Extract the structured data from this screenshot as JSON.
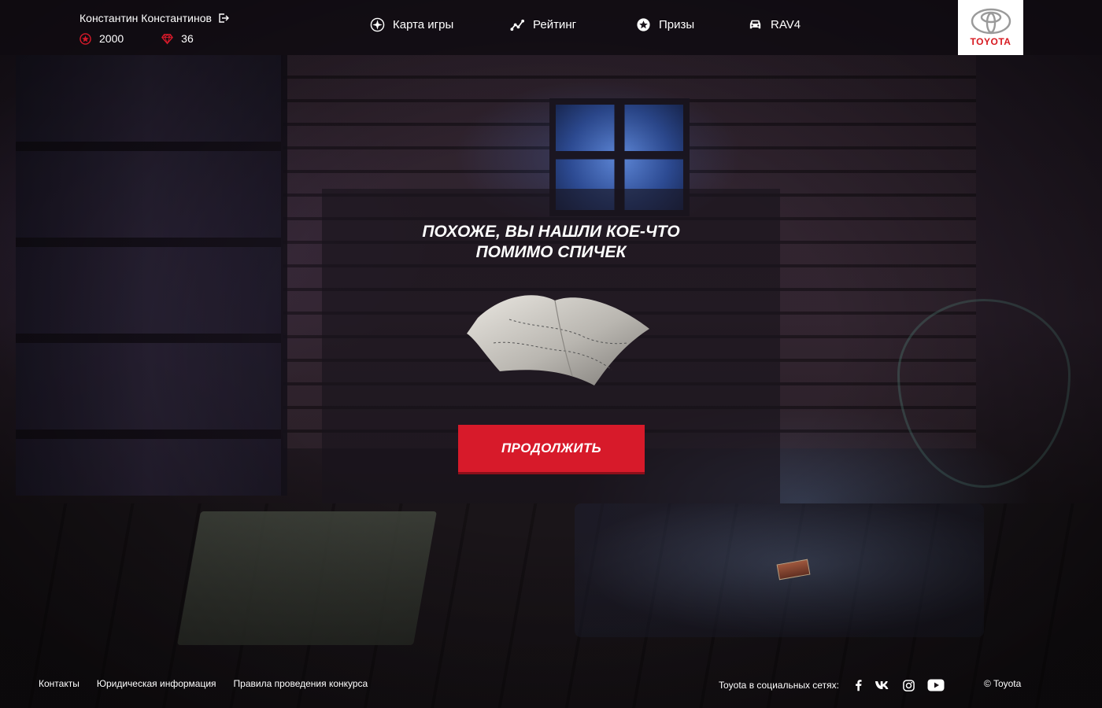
{
  "user": {
    "name": "Константин Константинов",
    "points": "2000",
    "gems": "36"
  },
  "nav": {
    "items": [
      {
        "label": "Карта игры",
        "icon": "compass-icon"
      },
      {
        "label": "Рейтинг",
        "icon": "chart-line-icon"
      },
      {
        "label": "Призы",
        "icon": "star-badge-icon"
      },
      {
        "label": "RAV4",
        "icon": "car-icon"
      }
    ]
  },
  "brand": {
    "name": "TOYOTA",
    "color": "#d71920"
  },
  "modal": {
    "title_line1": "Похоже, вы нашли кое-что",
    "title_line2": "помимо спичек",
    "found_item": "map-scroll",
    "button_label": "Продолжить",
    "button_color": "#d71a2a"
  },
  "footer": {
    "links": [
      "Контакты",
      "Юридическая информация",
      "Правила проведения конкурса"
    ],
    "social_label": "Toyota в социальных сетях:",
    "social_icons": [
      "facebook-icon",
      "vk-icon",
      "instagram-icon",
      "youtube-icon"
    ],
    "copyright": "© Toyota"
  }
}
